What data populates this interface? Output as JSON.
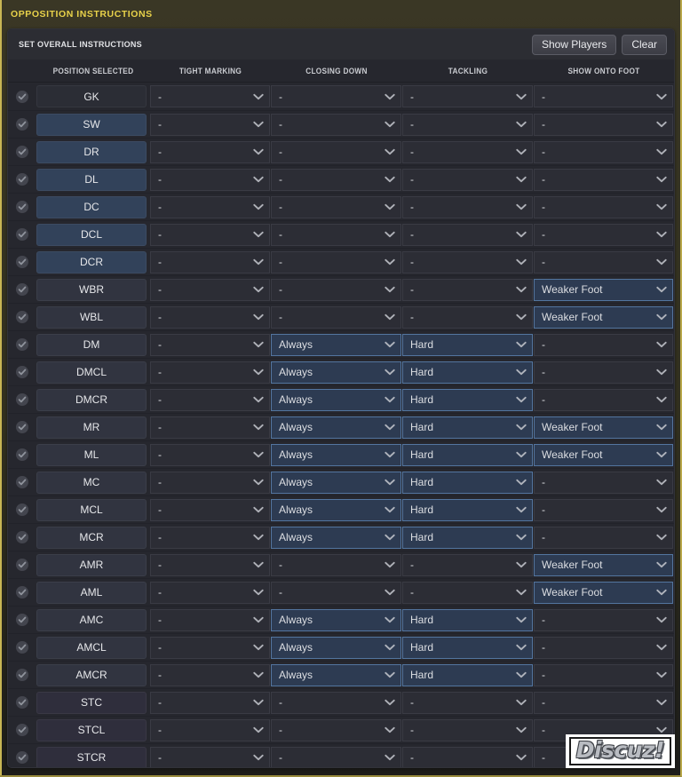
{
  "window": {
    "title": "OPPOSITION INSTRUCTIONS",
    "title_color": "#e8d24a"
  },
  "toolbar": {
    "title": "SET OVERALL INSTRUCTIONS",
    "show_players_label": "Show Players",
    "clear_label": "Clear"
  },
  "table": {
    "columns": [
      {
        "key": "position",
        "label": "POSITION SELECTED"
      },
      {
        "key": "tight_marking",
        "label": "TIGHT MARKING"
      },
      {
        "key": "closing_down",
        "label": "CLOSING DOWN"
      },
      {
        "key": "tackling",
        "label": "TACKLING"
      },
      {
        "key": "show_onto_foot",
        "label": "SHOW ONTO FOOT"
      }
    ],
    "empty_value": "-",
    "check_icon": "check-circle-icon",
    "chevron_icon": "chevron-down-icon",
    "rows": [
      {
        "position": "GK",
        "tone": "tone-dark",
        "tight_marking": "-",
        "closing_down": "-",
        "tackling": "-",
        "show_onto_foot": "-"
      },
      {
        "position": "SW",
        "tone": "tone-blue",
        "tight_marking": "-",
        "closing_down": "-",
        "tackling": "-",
        "show_onto_foot": "-"
      },
      {
        "position": "DR",
        "tone": "tone-blue",
        "tight_marking": "-",
        "closing_down": "-",
        "tackling": "-",
        "show_onto_foot": "-"
      },
      {
        "position": "DL",
        "tone": "tone-blue",
        "tight_marking": "-",
        "closing_down": "-",
        "tackling": "-",
        "show_onto_foot": "-"
      },
      {
        "position": "DC",
        "tone": "tone-blue",
        "tight_marking": "-",
        "closing_down": "-",
        "tackling": "-",
        "show_onto_foot": "-"
      },
      {
        "position": "DCL",
        "tone": "tone-blue",
        "tight_marking": "-",
        "closing_down": "-",
        "tackling": "-",
        "show_onto_foot": "-"
      },
      {
        "position": "DCR",
        "tone": "tone-blue",
        "tight_marking": "-",
        "closing_down": "-",
        "tackling": "-",
        "show_onto_foot": "-"
      },
      {
        "position": "WBR",
        "tone": "tone-slate",
        "tight_marking": "-",
        "closing_down": "-",
        "tackling": "-",
        "show_onto_foot": "Weaker Foot"
      },
      {
        "position": "WBL",
        "tone": "tone-slate",
        "tight_marking": "-",
        "closing_down": "-",
        "tackling": "-",
        "show_onto_foot": "Weaker Foot"
      },
      {
        "position": "DM",
        "tone": "tone-slate",
        "tight_marking": "-",
        "closing_down": "Always",
        "tackling": "Hard",
        "show_onto_foot": "-"
      },
      {
        "position": "DMCL",
        "tone": "tone-slate",
        "tight_marking": "-",
        "closing_down": "Always",
        "tackling": "Hard",
        "show_onto_foot": "-"
      },
      {
        "position": "DMCR",
        "tone": "tone-slate",
        "tight_marking": "-",
        "closing_down": "Always",
        "tackling": "Hard",
        "show_onto_foot": "-"
      },
      {
        "position": "MR",
        "tone": "tone-slate",
        "tight_marking": "-",
        "closing_down": "Always",
        "tackling": "Hard",
        "show_onto_foot": "Weaker Foot"
      },
      {
        "position": "ML",
        "tone": "tone-slate",
        "tight_marking": "-",
        "closing_down": "Always",
        "tackling": "Hard",
        "show_onto_foot": "Weaker Foot"
      },
      {
        "position": "MC",
        "tone": "tone-slate",
        "tight_marking": "-",
        "closing_down": "Always",
        "tackling": "Hard",
        "show_onto_foot": "-"
      },
      {
        "position": "MCL",
        "tone": "tone-slate",
        "tight_marking": "-",
        "closing_down": "Always",
        "tackling": "Hard",
        "show_onto_foot": "-"
      },
      {
        "position": "MCR",
        "tone": "tone-slate",
        "tight_marking": "-",
        "closing_down": "Always",
        "tackling": "Hard",
        "show_onto_foot": "-"
      },
      {
        "position": "AMR",
        "tone": "tone-slate",
        "tight_marking": "-",
        "closing_down": "-",
        "tackling": "-",
        "show_onto_foot": "Weaker Foot"
      },
      {
        "position": "AML",
        "tone": "tone-slate",
        "tight_marking": "-",
        "closing_down": "-",
        "tackling": "-",
        "show_onto_foot": "Weaker Foot"
      },
      {
        "position": "AMC",
        "tone": "tone-slate",
        "tight_marking": "-",
        "closing_down": "Always",
        "tackling": "Hard",
        "show_onto_foot": "-"
      },
      {
        "position": "AMCL",
        "tone": "tone-slate",
        "tight_marking": "-",
        "closing_down": "Always",
        "tackling": "Hard",
        "show_onto_foot": "-"
      },
      {
        "position": "AMCR",
        "tone": "tone-slate",
        "tight_marking": "-",
        "closing_down": "Always",
        "tackling": "Hard",
        "show_onto_foot": "-"
      },
      {
        "position": "STC",
        "tone": "tone-purple",
        "tight_marking": "-",
        "closing_down": "-",
        "tackling": "-",
        "show_onto_foot": "-"
      },
      {
        "position": "STCL",
        "tone": "tone-purple",
        "tight_marking": "-",
        "closing_down": "-",
        "tackling": "-",
        "show_onto_foot": "-"
      },
      {
        "position": "STCR",
        "tone": "tone-purple",
        "tight_marking": "-",
        "closing_down": "-",
        "tackling": "-",
        "show_onto_foot": "-"
      }
    ]
  },
  "watermark": {
    "text": "Discuz!"
  }
}
